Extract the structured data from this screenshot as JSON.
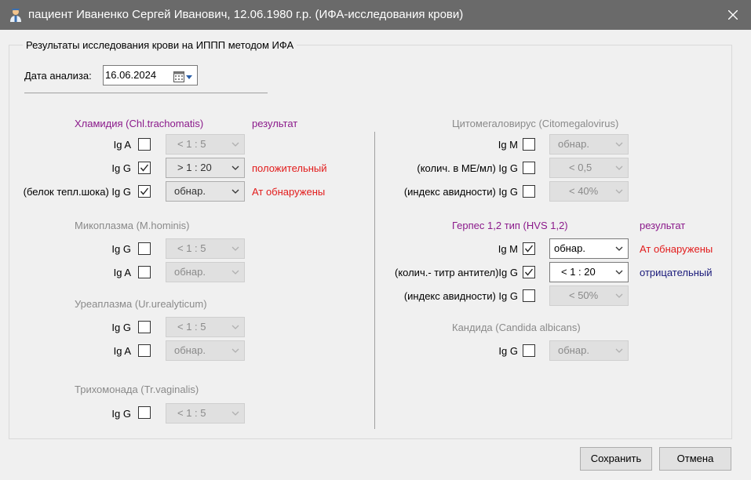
{
  "window": {
    "title": "пациент Иваненко Сергей Иванович, 12.06.1980 г.р. (ИФА-исследования крови)",
    "icon": "doctor-user-icon"
  },
  "group_title": "Результаты исследования крови на ИППП методом ИФА",
  "analysis_date": {
    "label": "Дата анализа:",
    "value": "16.06.2024",
    "icon": "calendar-icon"
  },
  "chlamydia": {
    "heading": "Хламидия (Chl.trachomatis)",
    "result_header": "результат",
    "rows": [
      {
        "label": "Ig A",
        "checked": false,
        "combo": "< 1 : 5",
        "result": ""
      },
      {
        "label": "Ig G",
        "checked": true,
        "combo": "> 1 : 20",
        "result": "положительный"
      },
      {
        "label": "(белок тепл.шока) Ig G",
        "checked": true,
        "combo": "обнар.",
        "result": "Ат обнаружены"
      }
    ]
  },
  "mycoplasma": {
    "heading": "Микоплазма (M.hominis)",
    "rows": [
      {
        "label": "Ig G",
        "checked": false,
        "combo": "< 1 : 5"
      },
      {
        "label": "Ig A",
        "checked": false,
        "combo": "обнар."
      }
    ]
  },
  "ureaplasma": {
    "heading": "Уреаплазма (Ur.urealyticum)",
    "rows": [
      {
        "label": "Ig G",
        "checked": false,
        "combo": "< 1 : 5"
      },
      {
        "label": "Ig A",
        "checked": false,
        "combo": "обнар."
      }
    ]
  },
  "trichomonas": {
    "heading": "Трихомонада (Tr.vaginalis)",
    "rows": [
      {
        "label": "Ig G",
        "checked": false,
        "combo": "< 1 : 5"
      }
    ]
  },
  "cmv": {
    "heading": "Цитомегаловирус (Citomegalovirus)",
    "rows": [
      {
        "label": "Ig M",
        "checked": false,
        "combo": "обнар."
      },
      {
        "label": "(колич. в МЕ/мл) Ig G",
        "checked": false,
        "combo": "< 0,5"
      },
      {
        "label": "(индекс авидности) Ig G",
        "checked": false,
        "combo": "< 40%"
      }
    ]
  },
  "herpes": {
    "heading": "Герпес 1,2 тип (HVS 1,2)",
    "result_header": "результат",
    "rows": [
      {
        "label": "Ig M",
        "checked": true,
        "combo": "обнар.",
        "result": "Ат обнаружены"
      },
      {
        "label": "(колич.- титр антител)Ig G",
        "checked": true,
        "combo": "< 1 : 20",
        "result": "отрицательный"
      },
      {
        "label": "(индекс авидности) Ig G",
        "checked": false,
        "combo": "< 50%",
        "result": ""
      }
    ]
  },
  "candida": {
    "heading": "Кандида (Candida albicans)",
    "rows": [
      {
        "label": "Ig G",
        "checked": false,
        "combo": "обнар."
      }
    ]
  },
  "buttons": {
    "save": "Сохранить",
    "cancel": "Отмена"
  },
  "colors": {
    "positive": "#e21b1b",
    "negative": "#1a1a7a",
    "heading_active": "#8b1a8b",
    "heading_inactive": "#8a8a8a"
  }
}
